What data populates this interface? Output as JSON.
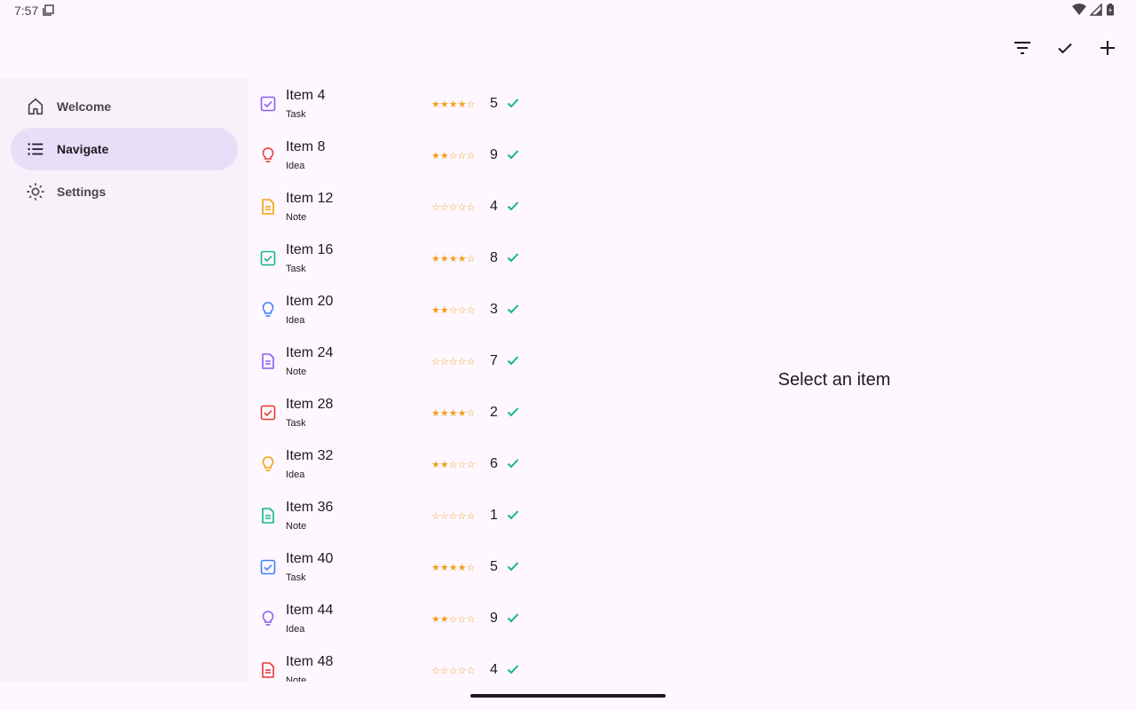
{
  "status_bar": {
    "time": "7:57",
    "icons": [
      "screenshot-icon",
      "wifi-icon",
      "signal-icon",
      "battery-icon"
    ]
  },
  "toolbar": {
    "actions": [
      "filter-icon",
      "check-icon",
      "add-icon"
    ]
  },
  "nav": {
    "items": [
      {
        "label": "Welcome",
        "icon": "home-icon",
        "active": false
      },
      {
        "label": "Navigate",
        "icon": "list-icon",
        "active": true
      },
      {
        "label": "Settings",
        "icon": "brightness-icon",
        "active": false
      }
    ]
  },
  "list": {
    "items": [
      {
        "title": "Item 4",
        "type": "Task",
        "stars": "★★★★☆",
        "rating": 4,
        "count": "5",
        "color": "#8b5cf6"
      },
      {
        "title": "Item 8",
        "type": "Idea",
        "stars": "★★☆☆☆",
        "rating": 2,
        "count": "9",
        "color": "#e53935"
      },
      {
        "title": "Item 12",
        "type": "Note",
        "stars": "☆☆☆☆☆",
        "rating": 0,
        "count": "4",
        "color": "#f59e0b"
      },
      {
        "title": "Item 16",
        "type": "Task",
        "stars": "★★★★☆",
        "rating": 4,
        "count": "8",
        "color": "#10b981"
      },
      {
        "title": "Item 20",
        "type": "Idea",
        "stars": "★★☆☆☆",
        "rating": 2,
        "count": "3",
        "color": "#3b82f6"
      },
      {
        "title": "Item 24",
        "type": "Note",
        "stars": "☆☆☆☆☆",
        "rating": 0,
        "count": "7",
        "color": "#8b5cf6"
      },
      {
        "title": "Item 28",
        "type": "Task",
        "stars": "★★★★☆",
        "rating": 4,
        "count": "2",
        "color": "#e53935"
      },
      {
        "title": "Item 32",
        "type": "Idea",
        "stars": "★★☆☆☆",
        "rating": 2,
        "count": "6",
        "color": "#f59e0b"
      },
      {
        "title": "Item 36",
        "type": "Note",
        "stars": "☆☆☆☆☆",
        "rating": 0,
        "count": "1",
        "color": "#10b981"
      },
      {
        "title": "Item 40",
        "type": "Task",
        "stars": "★★★★☆",
        "rating": 4,
        "count": "5",
        "color": "#3b82f6"
      },
      {
        "title": "Item 44",
        "type": "Idea",
        "stars": "★★☆☆☆",
        "rating": 2,
        "count": "9",
        "color": "#8b5cf6"
      },
      {
        "title": "Item 48",
        "type": "Note",
        "stars": "☆☆☆☆☆",
        "rating": 0,
        "count": "4",
        "color": "#e53935"
      }
    ],
    "check_color": "#10b981",
    "star_color": "#f0a020"
  },
  "detail": {
    "placeholder": "Select an item"
  }
}
